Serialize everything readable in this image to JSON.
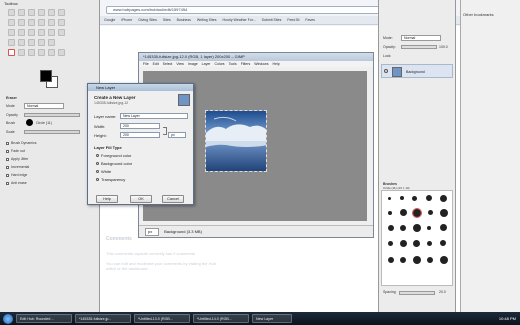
{
  "browser": {
    "url": "www.hubpages.com/hubtool/edit/1597454",
    "bookmarks": [
      "Google",
      "iPhone",
      "Giving Sites",
      "Sites",
      "Business",
      "Writing Sites",
      "Hourly Weather For...",
      "Submit Sites",
      "Feed Bl",
      "Faves"
    ],
    "page_text": [
      "Comments",
      "This comments capsule currently has 0 comments",
      "You can edit and moderate your comments by visiting the Hub editor or the dashboard..."
    ],
    "right_header": "Other bookmarks"
  },
  "toolbox": {
    "title": "Toolbox",
    "options_title": "Eraser",
    "mode_label": "Mode",
    "mode_value": "Normal",
    "opacity_label": "Opacity",
    "brush_label": "Brush",
    "brush_value": "Circle (11)",
    "scale_label": "Scale",
    "options": [
      "Brush Dynamics",
      "Fade out",
      "Apply Jitter",
      "Incremental",
      "Hard edge",
      "Anti erase"
    ]
  },
  "image_window": {
    "title": "*145335-fullsize.jpg-12.0 (RGB, 1 layer) 200x200 – GIMP",
    "menus": [
      "File",
      "Edit",
      "Select",
      "View",
      "Image",
      "Layer",
      "Colors",
      "Tools",
      "Filters",
      "Windows",
      "Help"
    ],
    "zoom": "px",
    "status": "Background (3.3 MB)"
  },
  "dialog": {
    "title": "New Layer",
    "heading": "Create a New Layer",
    "subheading": "145335-fullsize.jpg-12",
    "name_label": "Layer name:",
    "name_value": "New Layer",
    "width_label": "Width:",
    "width_value": "200",
    "height_label": "Height:",
    "height_value": "200",
    "unit": "px",
    "fill_label": "Layer Fill Type",
    "fill_options": [
      "Foreground color",
      "Background color",
      "White",
      "Transparency"
    ],
    "selected_fill": "White",
    "buttons": {
      "help": "Help",
      "ok": "OK",
      "cancel": "Cancel"
    }
  },
  "layers": {
    "mode_label": "Mode:",
    "mode_value": "Normal",
    "opacity_label": "Opacity:",
    "opacity_value": "100.0",
    "lock_label": "Lock:",
    "layer_name": "Background",
    "brushes_title": "Brushes",
    "brush_label": "Circle (11) (13 × 13)",
    "spacing_label": "Spacing",
    "spacing_value": "20.0"
  },
  "taskbar": {
    "items": [
      "Edit Hub: Rounded ...",
      "*145335-fullsize.jp...",
      "*Untitled-13.0 (RGB...",
      "*Untitled-14.0 (RGB...",
      "New Layer"
    ],
    "clock": "10:48 PM"
  },
  "colors": {
    "accent": "#3a5f86",
    "taskbar": "#0b121c",
    "dialog_title": "#a9bfd8"
  }
}
